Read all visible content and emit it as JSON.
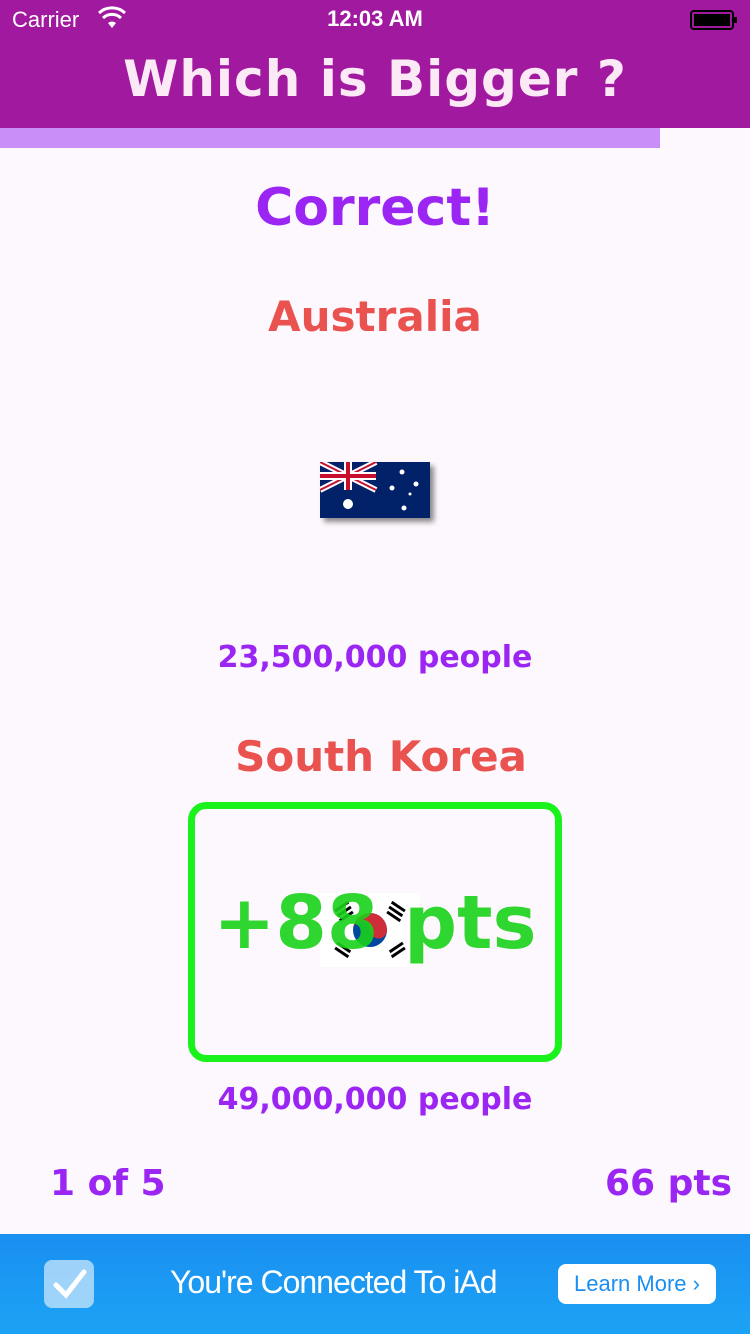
{
  "status_bar": {
    "carrier": "Carrier",
    "time": "12:03 AM"
  },
  "header": {
    "title": "Which is Bigger ?",
    "background_color": "#a0199e"
  },
  "progress": {
    "fraction": 0.88,
    "color": "#c98ef7"
  },
  "result": {
    "text": "Correct!",
    "color": "#9b26f3"
  },
  "countries": [
    {
      "name": "Australia",
      "flag_icon": "australia-flag-icon",
      "population": "23,500,000 people"
    },
    {
      "name": "South Korea",
      "flag_icon": "south-korea-flag-icon",
      "population": "49,000,000 people",
      "selected": true,
      "points_award": "+88 pts"
    }
  ],
  "footer": {
    "round": "1 of 5",
    "score": "66 pts"
  },
  "ad": {
    "text": "You're Connected To iAd",
    "button_label": "Learn More ›",
    "icon": "checkmark-icon"
  },
  "colors": {
    "accent": "#9b26f3",
    "country_name": "#e9524f",
    "selection_border": "#19f31b"
  }
}
